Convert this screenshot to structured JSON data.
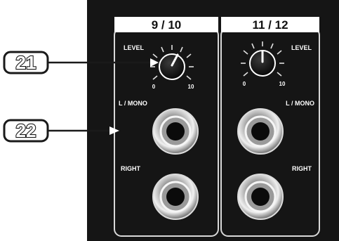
{
  "channels": [
    {
      "title": "9 / 10",
      "level_label": "LEVEL",
      "scale_min": "0",
      "scale_max": "10",
      "jack_top_label": "L / MONO",
      "jack_bottom_label": "RIGHT"
    },
    {
      "title": "11 / 12",
      "level_label": "LEVEL",
      "scale_min": "0",
      "scale_max": "10",
      "jack_top_label": "L / MONO",
      "jack_bottom_label": "RIGHT"
    }
  ],
  "callouts": [
    {
      "number": "21",
      "target": "level-knob"
    },
    {
      "number": "22",
      "target": "input-jacks"
    }
  ],
  "colors": {
    "panel": "#151515",
    "text": "#ffffff",
    "callout": "#1a1a1a"
  }
}
